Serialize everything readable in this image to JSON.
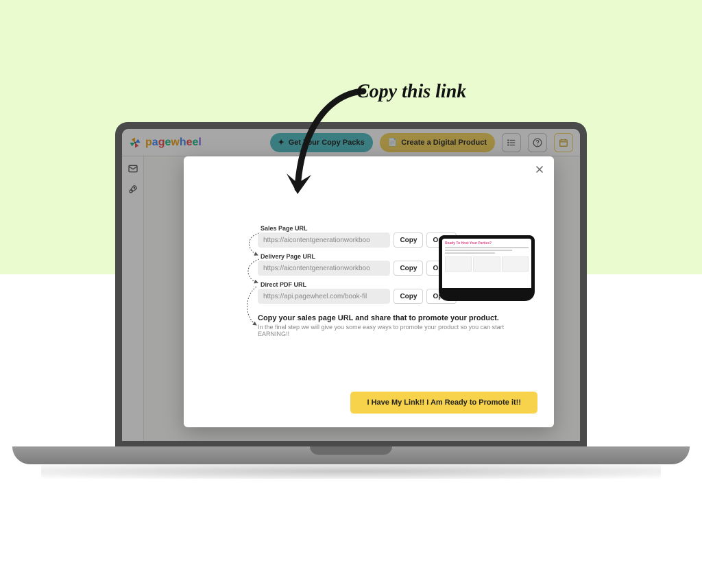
{
  "annotation": {
    "text": "Copy this link"
  },
  "app": {
    "brand": "pagewheel",
    "header": {
      "copy_packs_label": "Get Your Copy Packs",
      "create_product_label": "Create a Digital Product"
    }
  },
  "modal": {
    "urls": [
      {
        "label": "Sales Page URL",
        "value": "https://aicontentgenerationworkboo",
        "copy": "Copy",
        "open": "Open"
      },
      {
        "label": "Delivery Page URL",
        "value": "https://aicontentgenerationworkboo",
        "copy": "Copy",
        "open": "Open"
      },
      {
        "label": "Direct PDF URL",
        "value": "https://api.pagewheel.com/book-fil",
        "copy": "Copy",
        "open": "Open"
      }
    ],
    "note_heading": "Copy your sales page URL and share that to promote your product.",
    "note_sub": "In the final step we will give you some easy ways to promote your product so you can start EARNING!!",
    "cta": "I Have My Link!! I Am Ready to Promote it!!",
    "preview_title": "Ready To Host Your Parties?"
  }
}
